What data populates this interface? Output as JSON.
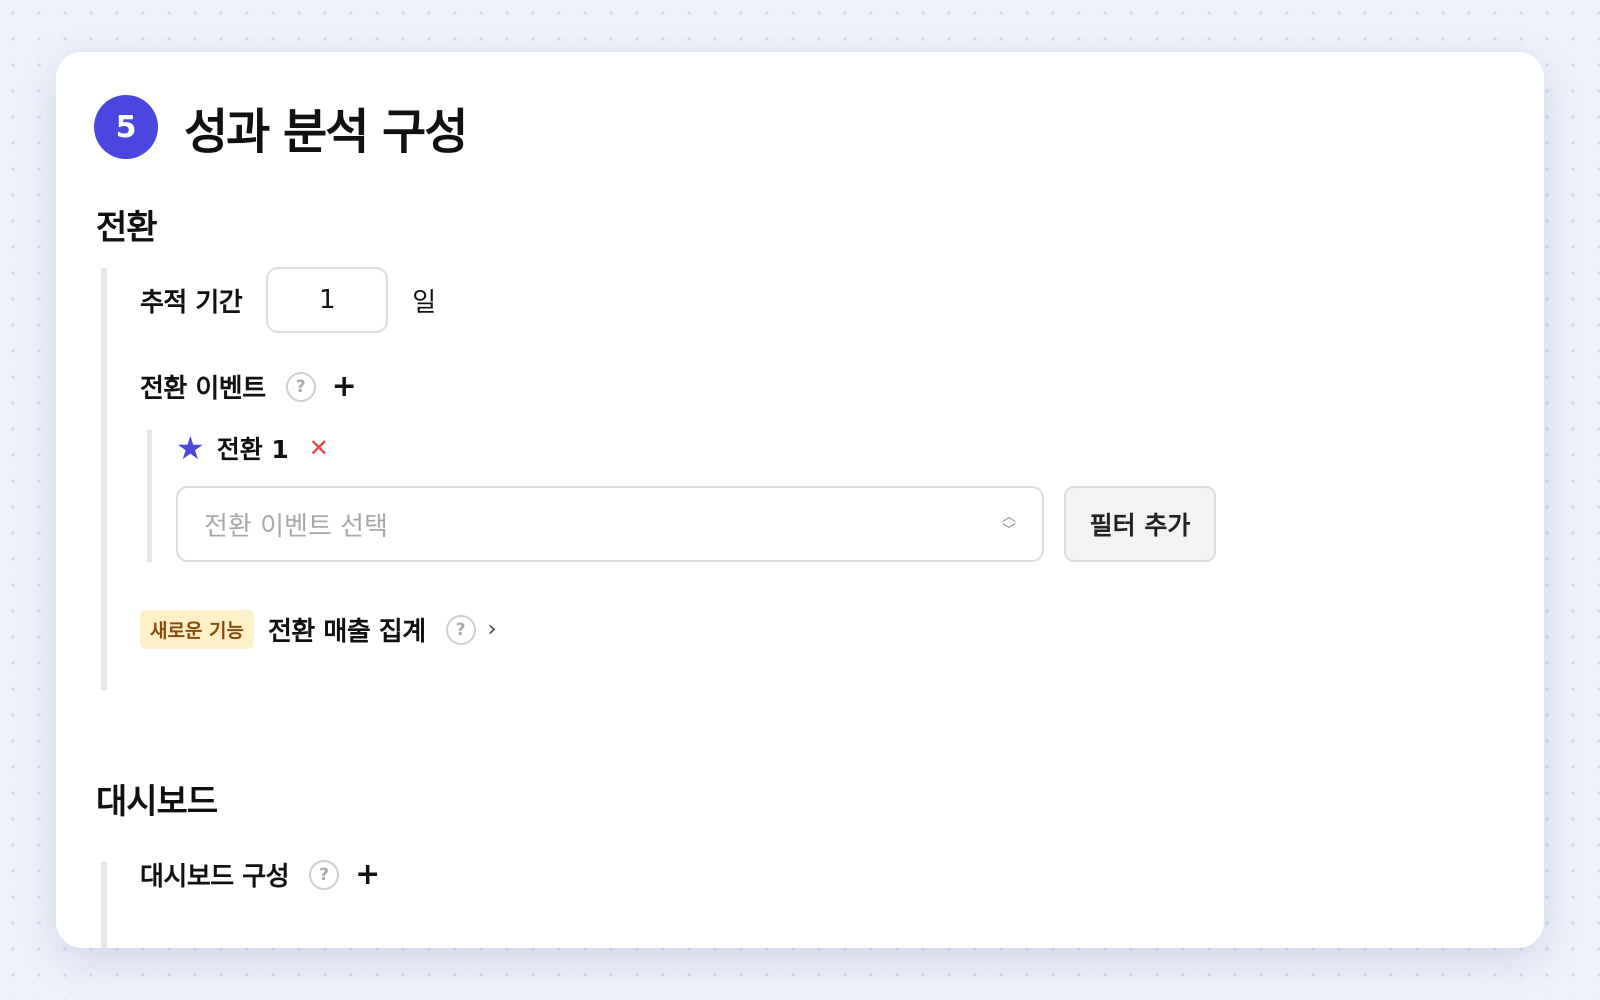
{
  "header": {
    "step_number": "5",
    "title": "성과 분석 구성"
  },
  "conversion": {
    "section_title": "전환",
    "tracking_period_label": "추적 기간",
    "tracking_period_value": "1",
    "tracking_period_unit": "일",
    "events_label": "전환 이벤트",
    "items": [
      {
        "name": "전환 1",
        "select_placeholder": "전환 이벤트 선택",
        "filter_button_label": "필터 추가"
      }
    ],
    "new_feature_badge": "새로운 기능",
    "revenue_label": "전환 매출 집계"
  },
  "dashboard": {
    "section_title": "대시보드",
    "config_label": "대시보드 구성"
  },
  "icons": {
    "help": "help-circle-icon",
    "add": "plus-icon",
    "star": "star-icon",
    "remove": "close-icon",
    "select": "chevron-up-down-icon",
    "expand": "chevron-right-icon"
  },
  "colors": {
    "accent": "#4a46e0",
    "danger": "#e64545",
    "badge_bg": "#fdf0c8",
    "badge_text": "#8a4a10"
  }
}
